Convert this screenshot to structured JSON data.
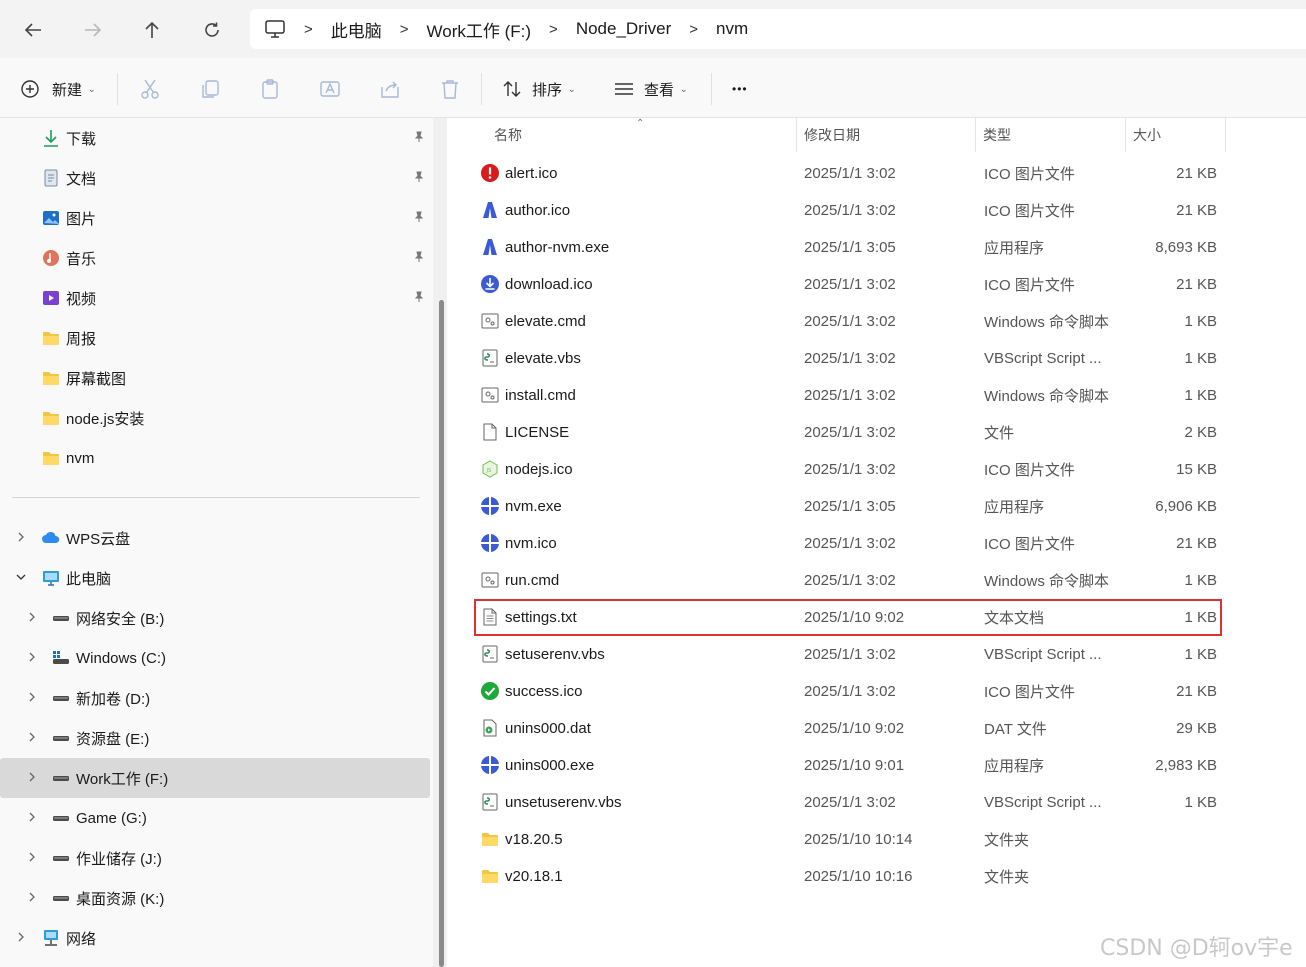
{
  "address": {
    "crumbs": [
      "此电脑",
      "Work工作 (F:)",
      "Node_Driver",
      "nvm"
    ]
  },
  "commands": {
    "new_label": "新建",
    "sort_label": "排序",
    "view_label": "查看",
    "more_label": "•••"
  },
  "sidebar": {
    "quick": [
      {
        "label": "下载",
        "icon": "download-icon"
      },
      {
        "label": "文档",
        "icon": "document-icon"
      },
      {
        "label": "图片",
        "icon": "pictures-icon"
      },
      {
        "label": "音乐",
        "icon": "music-icon"
      },
      {
        "label": "视频",
        "icon": "video-icon"
      },
      {
        "label": "周报",
        "icon": "folder-icon"
      },
      {
        "label": "屏幕截图",
        "icon": "folder-icon"
      },
      {
        "label": "node.js安装",
        "icon": "folder-icon"
      },
      {
        "label": "nvm",
        "icon": "folder-icon"
      }
    ],
    "tree": [
      {
        "label": "WPS云盘",
        "icon": "cloud-icon"
      },
      {
        "label": "此电脑",
        "icon": "pc-icon"
      },
      {
        "label": "网络安全 (B:)",
        "icon": "drive-icon"
      },
      {
        "label": "Windows (C:)",
        "icon": "windows-drive-icon"
      },
      {
        "label": "新加卷 (D:)",
        "icon": "drive-icon"
      },
      {
        "label": "资源盘 (E:)",
        "icon": "drive-icon"
      },
      {
        "label": "Work工作 (F:)",
        "icon": "drive-icon"
      },
      {
        "label": "Game (G:)",
        "icon": "drive-icon"
      },
      {
        "label": "作业储存 (J:)",
        "icon": "drive-icon"
      },
      {
        "label": "桌面资源 (K:)",
        "icon": "drive-icon"
      },
      {
        "label": "网络",
        "icon": "network-icon"
      }
    ]
  },
  "columns": {
    "name": "名称",
    "date": "修改日期",
    "type": "类型",
    "size": "大小"
  },
  "files": [
    {
      "name": "alert.ico",
      "date": "2025/1/1 3:02",
      "type": "ICO 图片文件",
      "size": "21 KB",
      "icon": "alert-icon"
    },
    {
      "name": "author.ico",
      "date": "2025/1/1 3:02",
      "type": "ICO 图片文件",
      "size": "21 KB",
      "icon": "author-icon"
    },
    {
      "name": "author-nvm.exe",
      "date": "2025/1/1 3:05",
      "type": "应用程序",
      "size": "8,693 KB",
      "icon": "author-icon"
    },
    {
      "name": "download.ico",
      "date": "2025/1/1 3:02",
      "type": "ICO 图片文件",
      "size": "21 KB",
      "icon": "download-circle-icon"
    },
    {
      "name": "elevate.cmd",
      "date": "2025/1/1 3:02",
      "type": "Windows 命令脚本",
      "size": "1 KB",
      "icon": "cmd-file-icon"
    },
    {
      "name": "elevate.vbs",
      "date": "2025/1/1 3:02",
      "type": "VBScript Script ...",
      "size": "1 KB",
      "icon": "vbs-file-icon"
    },
    {
      "name": "install.cmd",
      "date": "2025/1/1 3:02",
      "type": "Windows 命令脚本",
      "size": "1 KB",
      "icon": "cmd-file-icon"
    },
    {
      "name": "LICENSE",
      "date": "2025/1/1 3:02",
      "type": "文件",
      "size": "2 KB",
      "icon": "blank-file-icon"
    },
    {
      "name": "nodejs.ico",
      "date": "2025/1/1 3:02",
      "type": "ICO 图片文件",
      "size": "15 KB",
      "icon": "nodejs-icon"
    },
    {
      "name": "nvm.exe",
      "date": "2025/1/1 3:05",
      "type": "应用程序",
      "size": "6,906 KB",
      "icon": "nvm-icon"
    },
    {
      "name": "nvm.ico",
      "date": "2025/1/1 3:02",
      "type": "ICO 图片文件",
      "size": "21 KB",
      "icon": "nvm-icon"
    },
    {
      "name": "run.cmd",
      "date": "2025/1/1 3:02",
      "type": "Windows 命令脚本",
      "size": "1 KB",
      "icon": "cmd-file-icon"
    },
    {
      "name": "settings.txt",
      "date": "2025/1/10 9:02",
      "type": "文本文档",
      "size": "1 KB",
      "icon": "text-file-icon",
      "highlighted": true
    },
    {
      "name": "setuserenv.vbs",
      "date": "2025/1/1 3:02",
      "type": "VBScript Script ...",
      "size": "1 KB",
      "icon": "vbs-file-icon"
    },
    {
      "name": "success.ico",
      "date": "2025/1/1 3:02",
      "type": "ICO 图片文件",
      "size": "21 KB",
      "icon": "success-icon"
    },
    {
      "name": "unins000.dat",
      "date": "2025/1/10 9:02",
      "type": "DAT 文件",
      "size": "29 KB",
      "icon": "dat-file-icon"
    },
    {
      "name": "unins000.exe",
      "date": "2025/1/10 9:01",
      "type": "应用程序",
      "size": "2,983 KB",
      "icon": "nvm-icon"
    },
    {
      "name": "unsetuserenv.vbs",
      "date": "2025/1/1 3:02",
      "type": "VBScript Script ...",
      "size": "1 KB",
      "icon": "vbs-file-icon"
    },
    {
      "name": "v18.20.5",
      "date": "2025/1/10 10:14",
      "type": "文件夹",
      "size": "",
      "icon": "folder-icon"
    },
    {
      "name": "v20.18.1",
      "date": "2025/1/10 10:16",
      "type": "文件夹",
      "size": "",
      "icon": "folder-icon"
    }
  ],
  "watermark": "CSDN @D轲ov宇e",
  "colors": {
    "highlight_border": "#e03131",
    "selected_nav": "#d9d9d9",
    "accent": "#2f6fd6"
  }
}
